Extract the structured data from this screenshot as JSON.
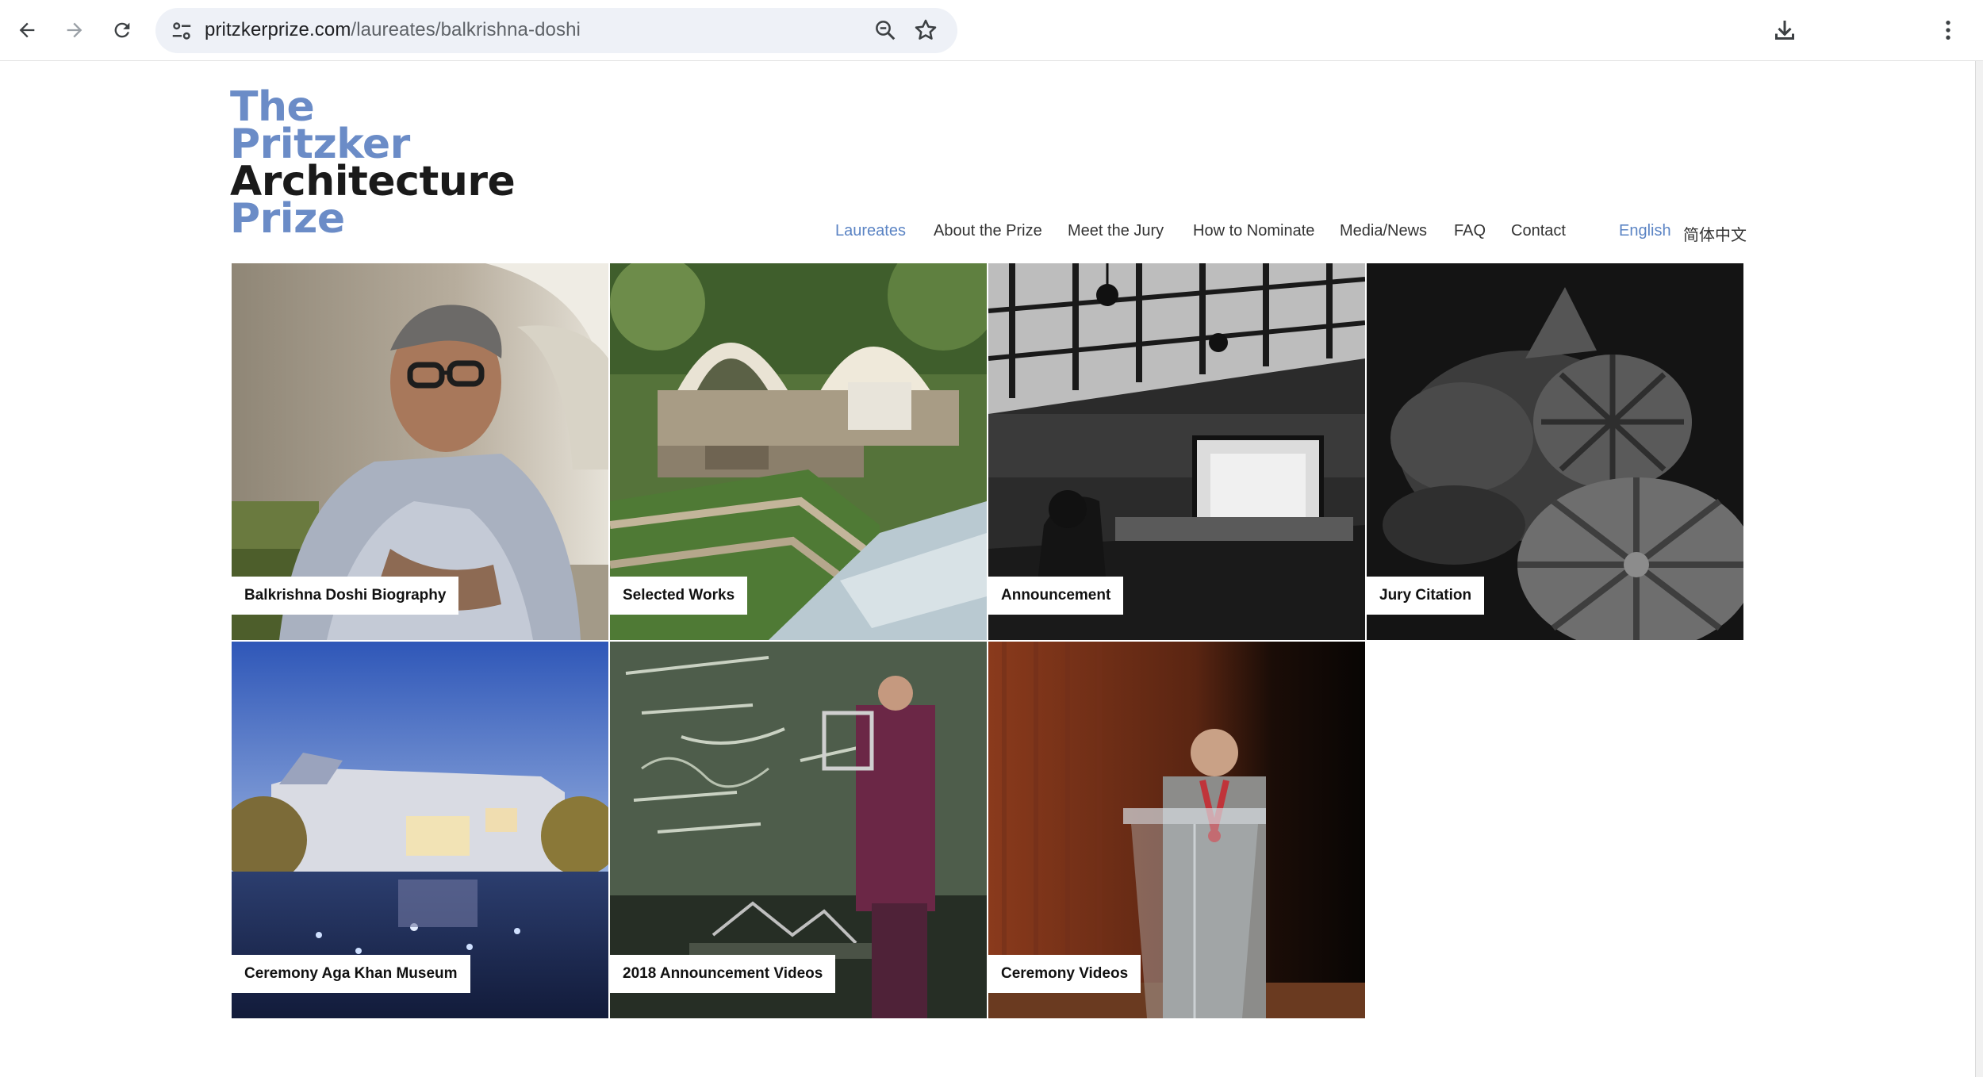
{
  "browser": {
    "url_domain": "pritzkerprize.com",
    "url_path": "/laureates/balkrishna-doshi"
  },
  "site": {
    "logo_lines": [
      "The",
      "Pritzker",
      "Architecture",
      "Prize"
    ],
    "nav": [
      {
        "label": "Laureates",
        "active": true
      },
      {
        "label": "About the Prize"
      },
      {
        "label": "Meet the Jury"
      },
      {
        "label": "How to Nominate"
      },
      {
        "label": "Media/News"
      },
      {
        "label": "FAQ"
      },
      {
        "label": "Contact"
      }
    ],
    "languages": [
      {
        "label": "English",
        "active": true
      },
      {
        "label": "简体中文"
      }
    ]
  },
  "tiles": [
    {
      "label": "Balkrishna Doshi Biography"
    },
    {
      "label": "Selected Works"
    },
    {
      "label": "Announcement"
    },
    {
      "label": "Jury Citation"
    },
    {
      "label": "Ceremony Aga Khan Museum"
    },
    {
      "label": "2018 Announcement Videos"
    },
    {
      "label": "Ceremony Videos"
    }
  ],
  "colors": {
    "accent": "#5b84c4",
    "logo_blue": "#6b8cc7"
  }
}
